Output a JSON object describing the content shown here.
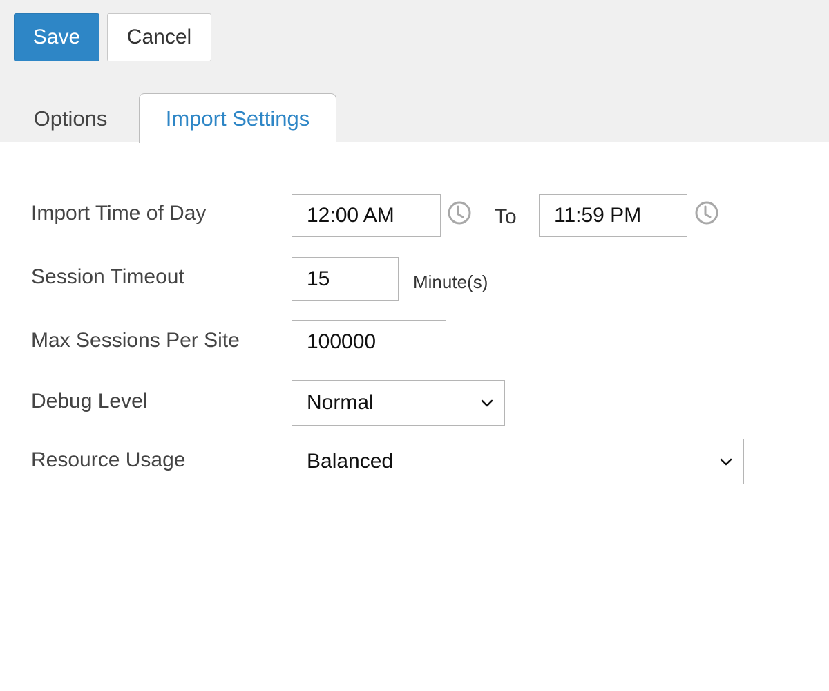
{
  "toolbar": {
    "save_label": "Save",
    "cancel_label": "Cancel",
    "accent_color": "#2e86c6"
  },
  "tabs": [
    {
      "label": "Options",
      "active": false
    },
    {
      "label": "Import Settings",
      "active": true
    }
  ],
  "form": {
    "import_time": {
      "label": "Import Time of Day",
      "from_value": "12:00 AM",
      "separator": "To",
      "to_value": "11:59 PM",
      "icon": "clock-icon"
    },
    "session_timeout": {
      "label": "Session Timeout",
      "value": "15",
      "unit": "Minute(s)"
    },
    "max_sessions": {
      "label": "Max Sessions Per Site",
      "value": "100000"
    },
    "debug_level": {
      "label": "Debug Level",
      "selected": "Normal"
    },
    "resource_usage": {
      "label": "Resource Usage",
      "selected": "Balanced"
    }
  }
}
